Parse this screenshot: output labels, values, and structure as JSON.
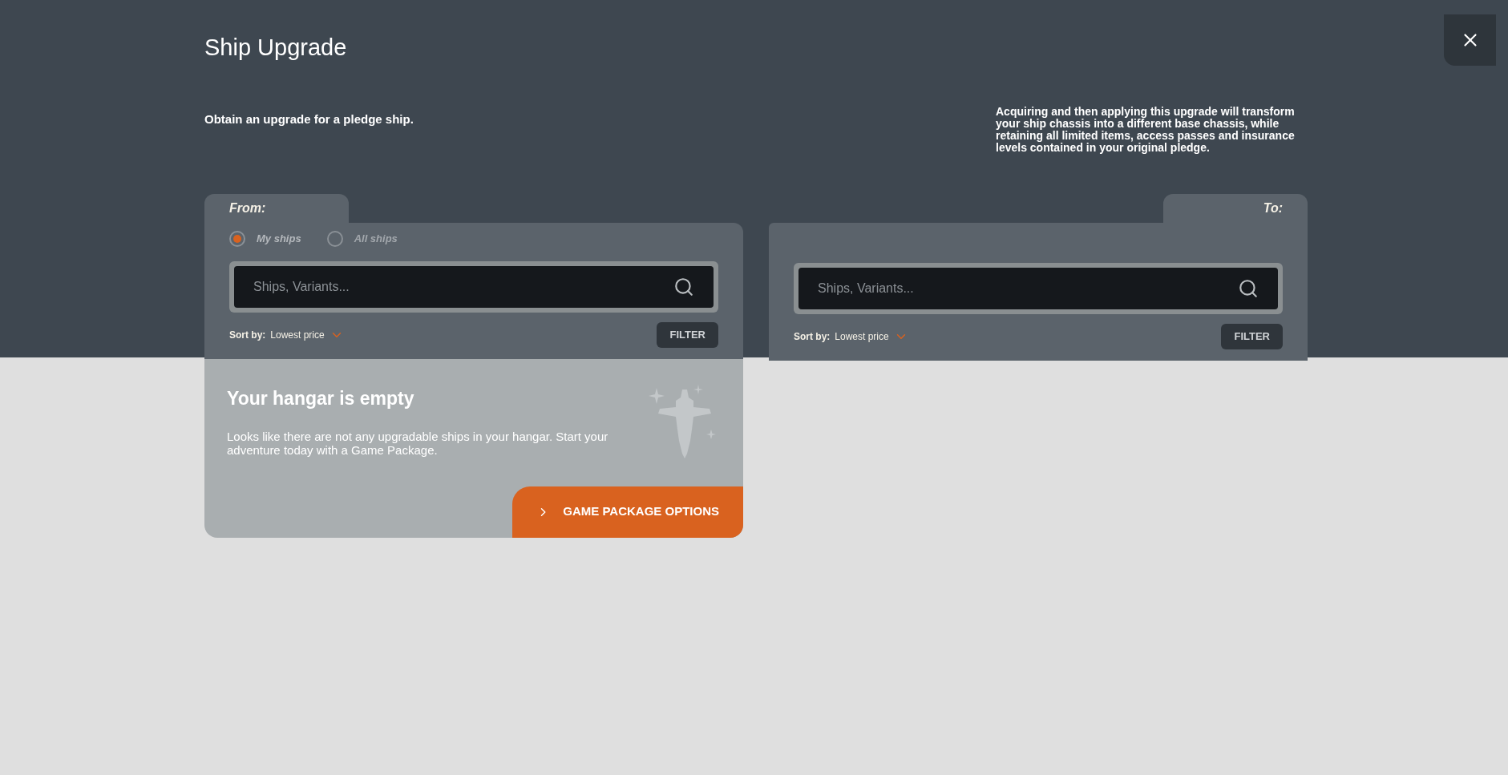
{
  "header": {
    "title": "Ship Upgrade",
    "subtitle": "Obtain an upgrade for a pledge ship.",
    "description": "Acquiring and then applying this upgrade will transform your ship chassis into a different base chassis, while retaining all limited items, access passes and insurance levels contained in your original pledge."
  },
  "panels": [
    {
      "tab_label": "From:",
      "radio_options": [
        {
          "label": "My ships",
          "selected": true
        },
        {
          "label": "All ships",
          "selected": false
        }
      ],
      "search": {
        "placeholder": "Ships, Variants..."
      },
      "sort": {
        "label": "Sort by:",
        "value": "Lowest price"
      },
      "filter_button": "FILTER",
      "empty_state": {
        "title": "Your hangar is empty",
        "message": "Looks like there are not any upgradable ships in your hangar. Start your adventure today with a Game Package.",
        "button": "GAME PACKAGE OPTIONS"
      }
    },
    {
      "tab_label": "To:",
      "search": {
        "placeholder": "Ships, Variants..."
      },
      "sort": {
        "label": "Sort by:",
        "value": "Lowest price"
      },
      "filter_button": "FILTER"
    }
  ]
}
